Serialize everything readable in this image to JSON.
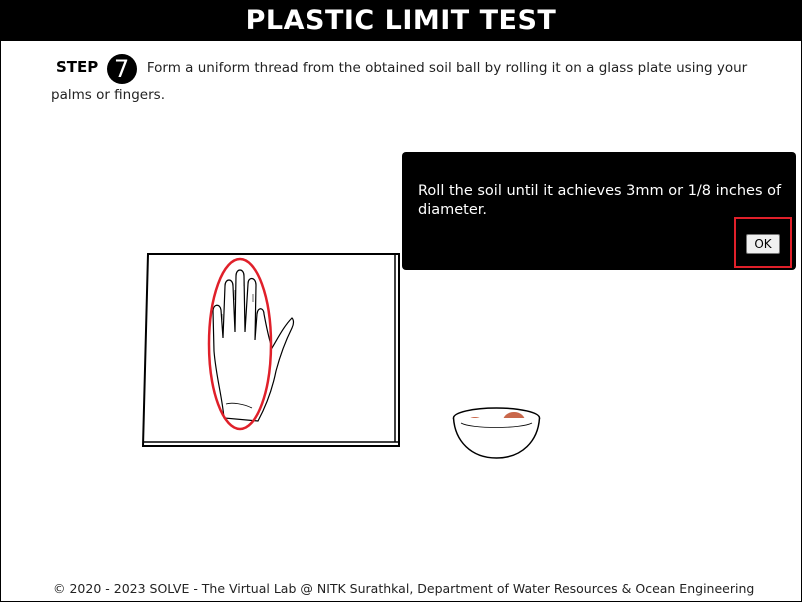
{
  "header": {
    "title": "PLASTIC LIMIT TEST"
  },
  "step": {
    "label": "STEP",
    "number": "7",
    "text": "Form a uniform thread from the obtained soil ball by rolling it on a glass plate using your palms or fingers."
  },
  "popup": {
    "message": "Roll the soil until it achieves 3mm or 1/8 inches of diameter.",
    "ok_label": "OK"
  },
  "footer": {
    "copyright": "© 2020 - 2023 SOLVE - The Virtual Lab @ NITK Surathkal, Department of Water Resources & Ocean Engineering"
  },
  "colors": {
    "highlight": "#e0202a",
    "soil": "#c9674a",
    "popup_bg": "#000000"
  }
}
